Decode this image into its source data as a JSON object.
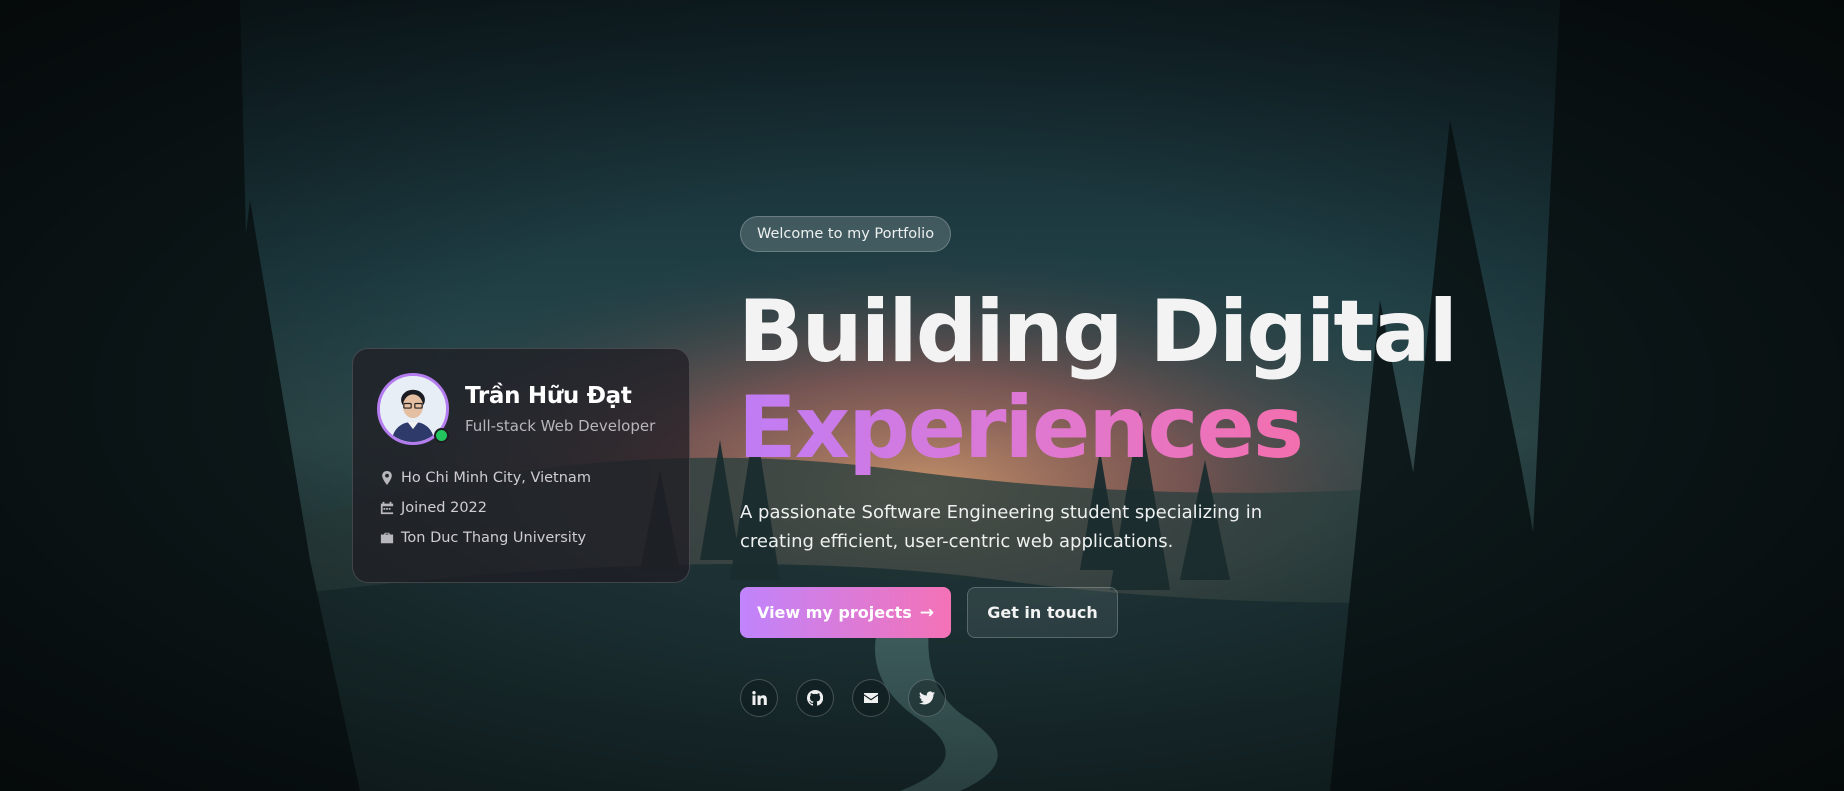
{
  "colors": {
    "accent_start": "#c084fc",
    "accent_end": "#f472b6",
    "status_online": "#22c55e"
  },
  "profile": {
    "name": "Trần Hữu Đạt",
    "role": "Full-stack Web Developer",
    "avatar_icon": "avatar-photo",
    "details": [
      {
        "icon": "map-pin-icon",
        "text": "Ho Chi Minh City, Vietnam"
      },
      {
        "icon": "calendar-icon",
        "text": "Joined 2022"
      },
      {
        "icon": "briefcase-icon",
        "text": "Ton Duc Thang University"
      }
    ]
  },
  "hero": {
    "badge": "Welcome to my Portfolio",
    "title_line1": "Building Digital",
    "title_line2": "Experiences",
    "description": "A passionate Software Engineering student specializing in creating efficient, user-centric web applications.",
    "primary_button": "View my projects",
    "primary_button_icon": "arrow-right-icon",
    "secondary_button": "Get in touch"
  },
  "socials": [
    {
      "icon": "linkedin-icon"
    },
    {
      "icon": "github-icon"
    },
    {
      "icon": "mail-icon"
    },
    {
      "icon": "twitter-icon"
    }
  ]
}
